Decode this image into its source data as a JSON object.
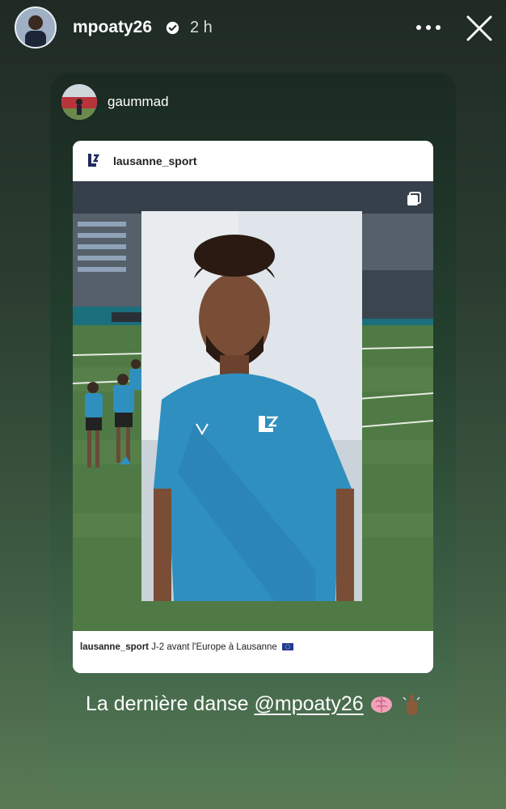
{
  "story": {
    "owner": "mpoaty26",
    "time": "2 h",
    "text_prefix": "La dernière danse ",
    "mention": "@mpoaty26",
    "emojis": [
      "brain-icon",
      "pointing-up-icon"
    ]
  },
  "shared_post": {
    "sharer": "gaummad",
    "author": "lausanne_sport",
    "caption_user": "lausanne_sport",
    "caption_text": " J-2 avant l'Europe à Lausanne",
    "caption_flag": "eu-flag-icon"
  },
  "colors": {
    "jersey": "#2f8fbf",
    "pitch": "#4f7a45",
    "verified": "#3897f0"
  }
}
